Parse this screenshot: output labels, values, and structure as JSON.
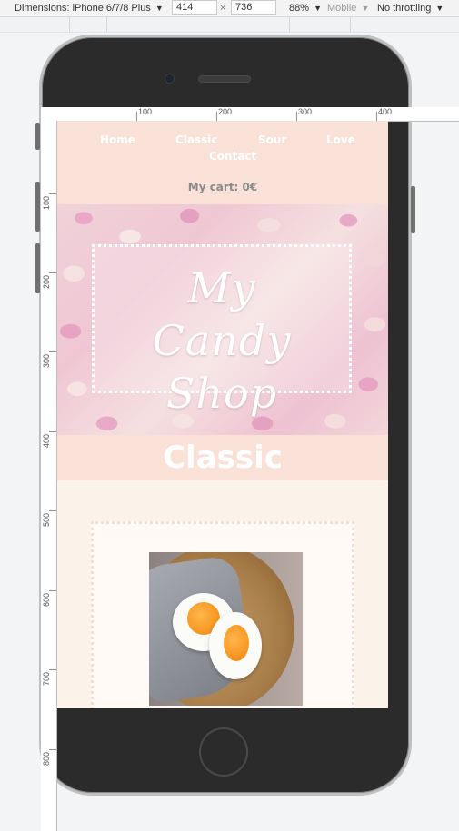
{
  "devtools": {
    "dimensions_label": "Dimensions: iPhone 6/7/8 Plus",
    "width_value": "414",
    "times": "×",
    "height_value": "736",
    "zoom": "88%",
    "mode": "Mobile",
    "throttling": "No throttling",
    "caret": "▼"
  },
  "rulers": {
    "horizontal": [
      "100",
      "200",
      "300",
      "400"
    ],
    "vertical": [
      "100",
      "200",
      "300",
      "400",
      "500",
      "600",
      "700",
      "800"
    ]
  },
  "site": {
    "nav": {
      "home": "Home",
      "classic": "Classic",
      "sour": "Sour",
      "love": "Love",
      "contact": "Contact"
    },
    "cart": "My cart: 0€",
    "hero_title_line1": "My",
    "hero_title_line2": "Candy Shop",
    "section_title": "Classic"
  },
  "colors": {
    "header_bg": "#f9e1d8",
    "page_bg": "#fbf3ea",
    "phone_body": "#2b2b2b"
  }
}
